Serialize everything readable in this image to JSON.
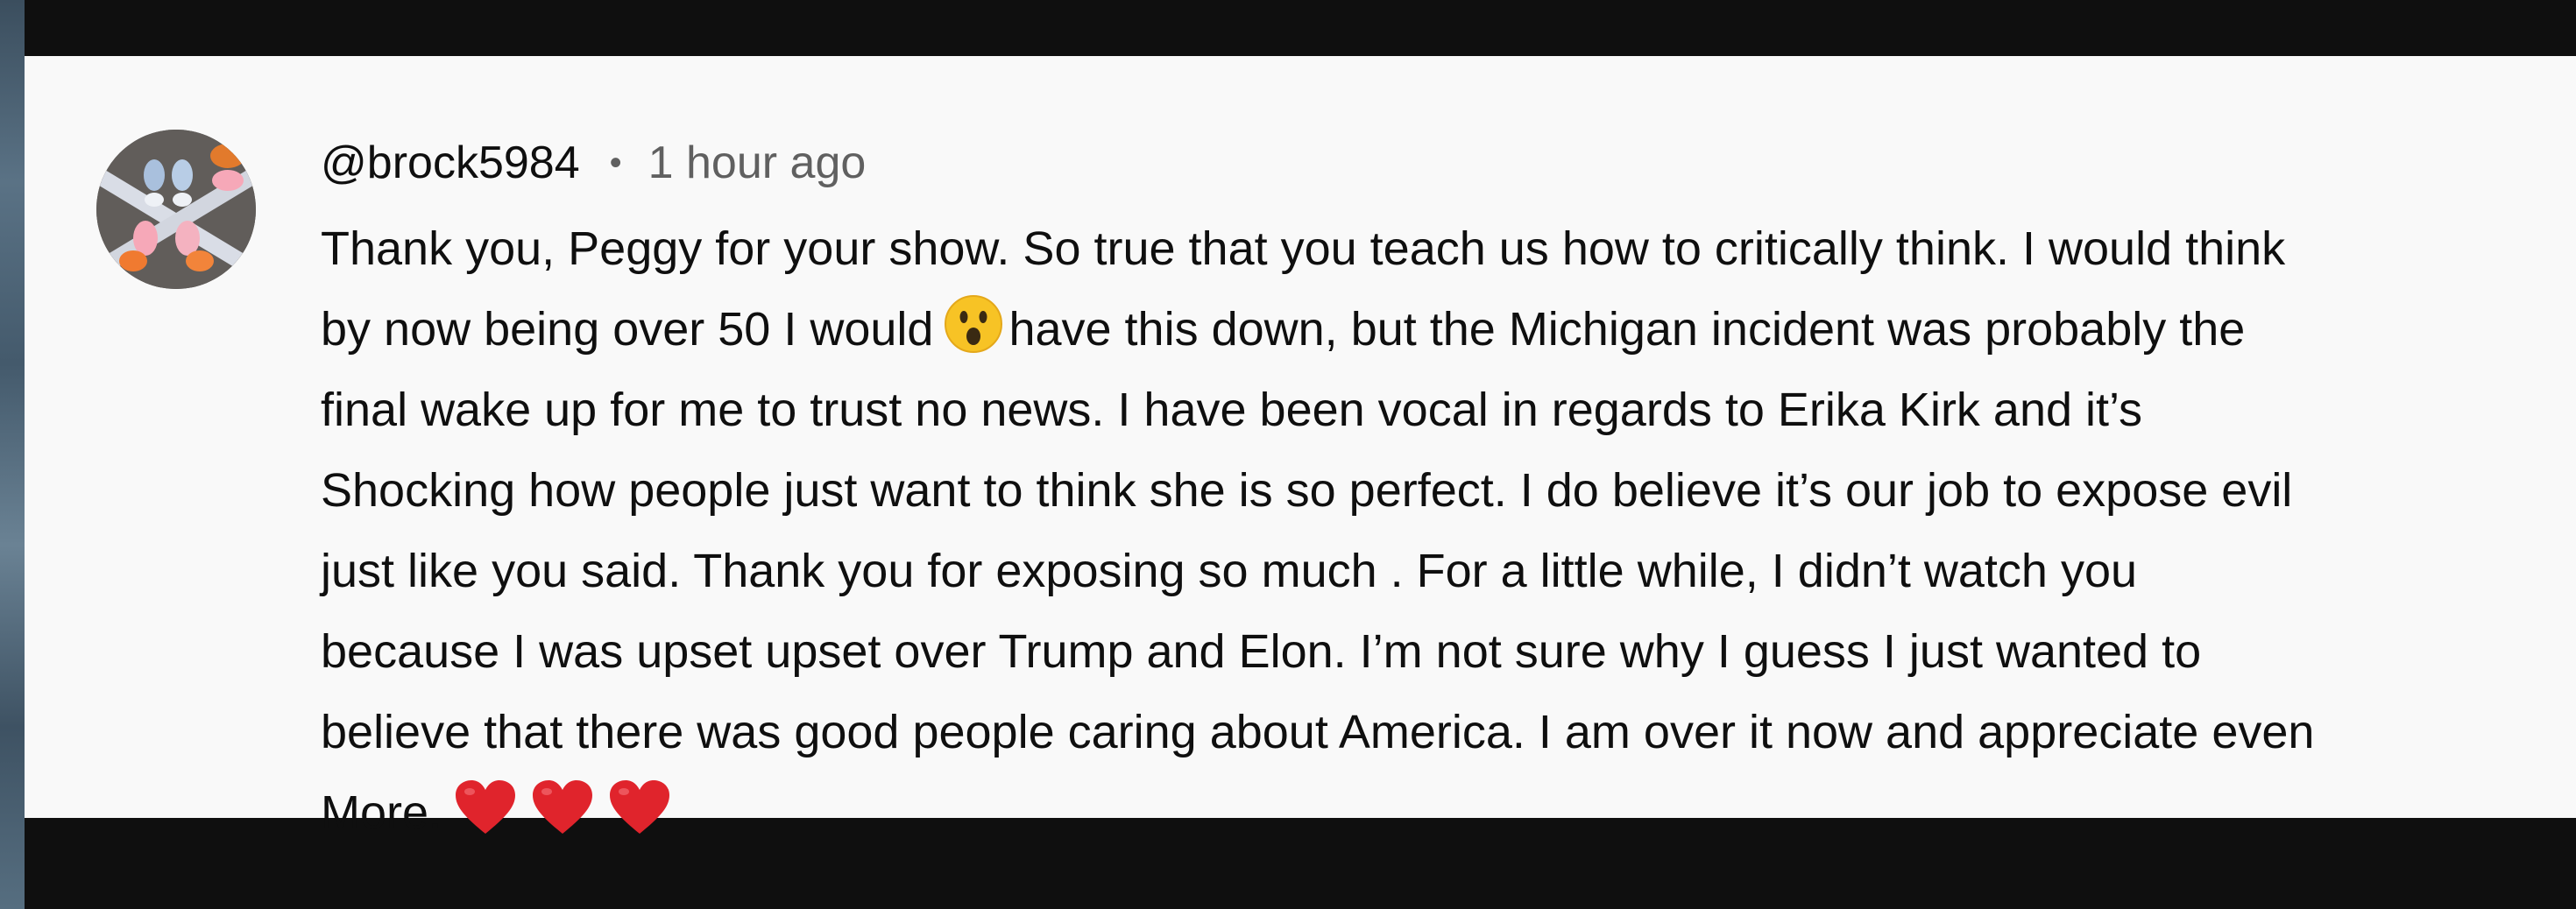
{
  "comment": {
    "author": "@brock5984",
    "separator": "•",
    "timestamp": "1 hour ago",
    "lines": [
      "Thank you, Peggy for your show. So true that you teach us how to critically think. I would think",
      "by now being over 50 I would",
      "have this down, but the Michigan incident was probably the",
      "final wake up for me to trust no news. I have been vocal in regards to Erika Kirk and it’s",
      "Shocking how people just want to think she is so perfect. I do believe it’s our job to expose evil",
      "just like you said.  Thank you for exposing so much . For a little while, I didn’t watch you",
      "because I was upset upset over Trump and Elon. I’m not sure why I guess I just wanted to",
      "believe that there was good people caring about America. I am over it now and appreciate even",
      "More."
    ],
    "emojis": {
      "surprised": "hushed-face-emoji",
      "hearts": [
        "red-heart-emoji",
        "red-heart-emoji",
        "red-heart-emoji"
      ]
    }
  },
  "colors": {
    "background_dark": "#0f0f0f",
    "panel": "#f9f9f9",
    "text_primary": "#0f0f0f",
    "text_secondary": "#606060",
    "heart_red": "#e0242c",
    "emoji_yellow": "#f7c325"
  }
}
